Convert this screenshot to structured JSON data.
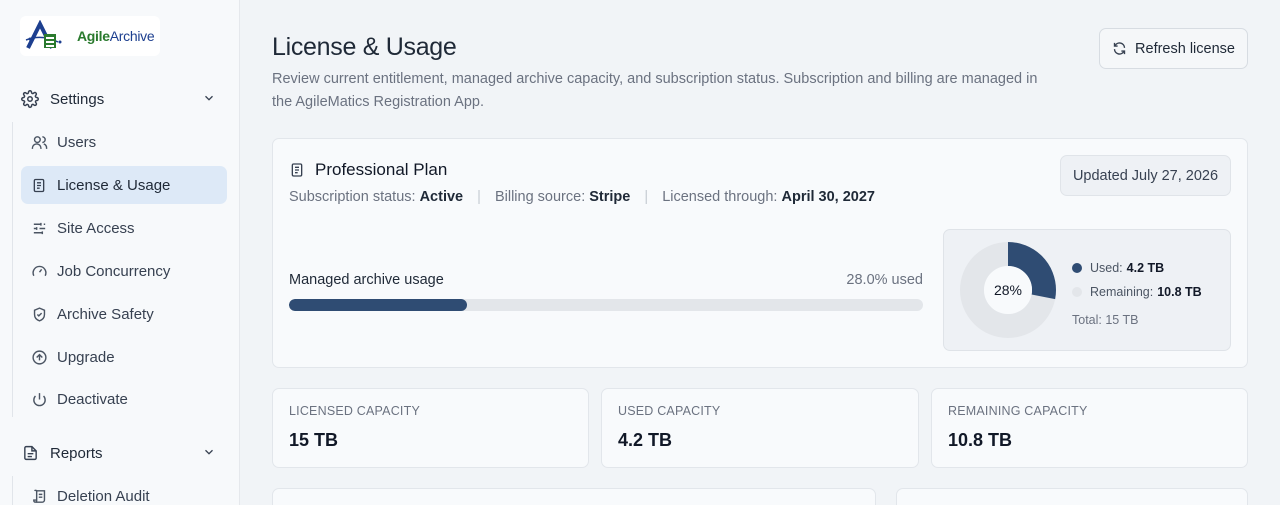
{
  "brand": {
    "logo_text_1": "Agile",
    "logo_text_2": "Archive"
  },
  "sidebar": {
    "settings": {
      "label": "Settings",
      "icon": "gear-icon"
    },
    "items": [
      {
        "label": "Users",
        "icon": "users-icon",
        "active": false
      },
      {
        "label": "License & Usage",
        "icon": "document-icon",
        "active": true
      },
      {
        "label": "Site Access",
        "icon": "sliders-icon",
        "active": false
      },
      {
        "label": "Job Concurrency",
        "icon": "gauge-icon",
        "active": false
      },
      {
        "label": "Archive Safety",
        "icon": "shield-icon",
        "active": false
      },
      {
        "label": "Upgrade",
        "icon": "arrow-up-circle-icon",
        "active": false
      },
      {
        "label": "Deactivate",
        "icon": "power-icon",
        "active": false
      }
    ],
    "reports": {
      "label": "Reports",
      "icon": "report-icon"
    },
    "report_items": [
      {
        "label": "Deletion Audit",
        "icon": "scroll-icon"
      }
    ]
  },
  "header": {
    "title": "License & Usage",
    "description": "Review current entitlement, managed archive capacity, and subscription status. Subscription and billing are managed in the AgileMatics Registration App.",
    "refresh_label": "Refresh license"
  },
  "plan": {
    "name": "Professional Plan",
    "status_label": "Subscription status:",
    "status_value": "Active",
    "billing_label": "Billing source:",
    "billing_value": "Stripe",
    "licensed_label": "Licensed through:",
    "licensed_value": "April 30, 2027",
    "updated": "Updated July 27, 2026"
  },
  "usage": {
    "label": "Managed archive usage",
    "percent_text": "28.0% used",
    "fraction": 0.28,
    "donut_label": "28%",
    "used_label": "Used:",
    "used_value": "4.2 TB",
    "remaining_label": "Remaining:",
    "remaining_value": "10.8 TB",
    "total_text": "Total: 15 TB"
  },
  "stats": [
    {
      "label": "LICENSED CAPACITY",
      "value": "15 TB"
    },
    {
      "label": "USED CAPACITY",
      "value": "4.2 TB"
    },
    {
      "label": "REMAINING CAPACITY",
      "value": "10.8 TB"
    }
  ],
  "colors": {
    "accent": "#2f4c73",
    "active_bg": "#dde9f7",
    "track": "#e3e6ea"
  }
}
